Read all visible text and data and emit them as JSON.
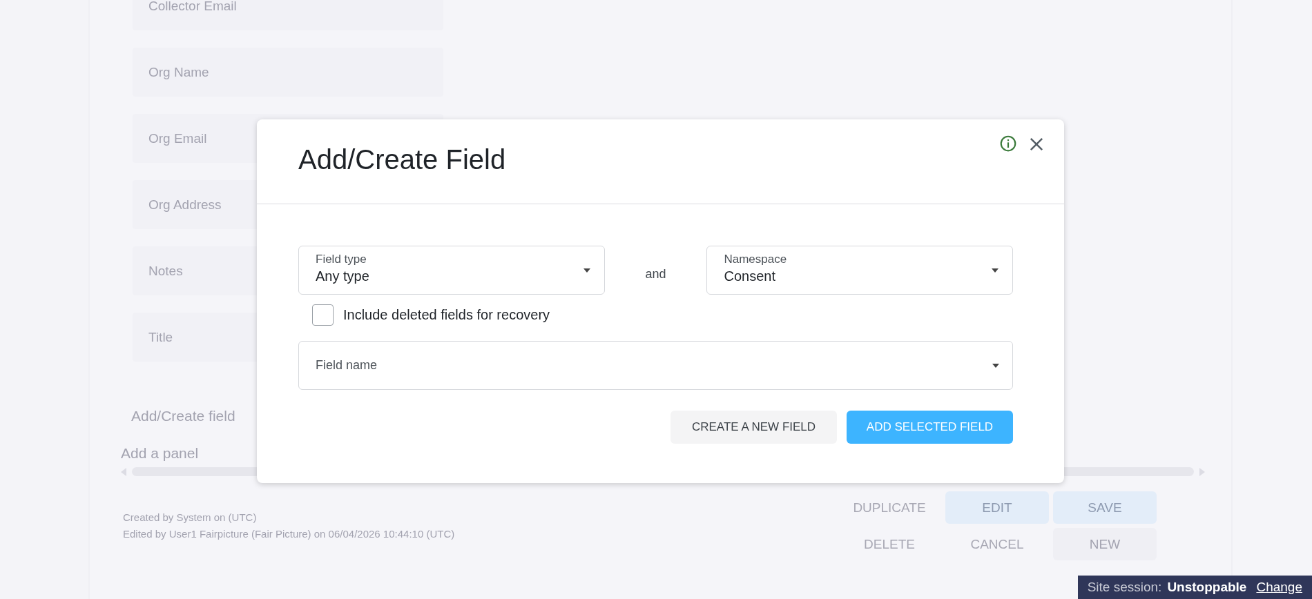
{
  "background": {
    "fields": [
      "Collector Email",
      "Org Name",
      "Org Email",
      "Org Address",
      "Notes",
      "Title"
    ],
    "add_field_link": "Add/Create field",
    "add_panel": "Add a panel",
    "created": "Created by System on (UTC)",
    "edited": "Edited by User1 Fairpicture (Fair Picture) on 06/04/2026 10:44:10 (UTC)",
    "buttons": [
      {
        "label": "DUPLICATE",
        "kind": "text"
      },
      {
        "label": "EDIT",
        "kind": "filled"
      },
      {
        "label": "SAVE",
        "kind": "filled"
      },
      {
        "label": "DELETE",
        "kind": "text"
      },
      {
        "label": "CANCEL",
        "kind": "text"
      },
      {
        "label": "NEW",
        "kind": "outlined"
      }
    ]
  },
  "dialog": {
    "title": "Add/Create Field",
    "field_type": {
      "label": "Field type",
      "value": "Any type"
    },
    "joiner": "and",
    "namespace": {
      "label": "Namespace",
      "value": "Consent"
    },
    "include_deleted": {
      "label": "Include deleted fields for recovery",
      "checked": false
    },
    "field_name": {
      "placeholder": "Field name"
    },
    "buttons": [
      {
        "label": "CREATE A NEW FIELD",
        "kind": "secondary"
      },
      {
        "label": "ADD SELECTED FIELD",
        "kind": "primary"
      }
    ]
  },
  "session_bar": {
    "label": "Site session:",
    "value": "Unstoppable",
    "link": "Change"
  }
}
